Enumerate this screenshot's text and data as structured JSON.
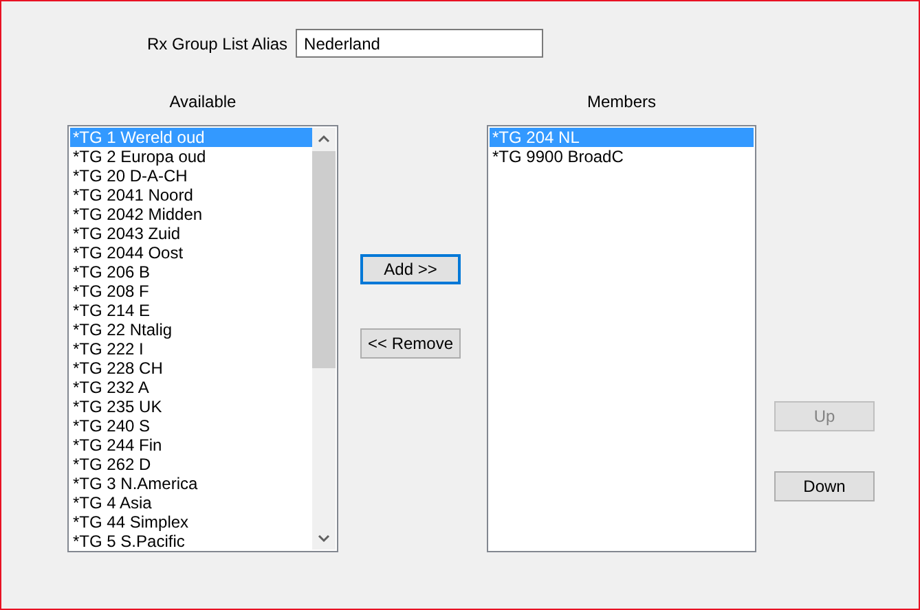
{
  "alias": {
    "label": "Rx Group List Alias",
    "value": "Nederland"
  },
  "available": {
    "label": "Available",
    "items": [
      {
        "text": "*TG 1 Wereld oud",
        "selected": true
      },
      {
        "text": "*TG 2 Europa oud",
        "selected": false
      },
      {
        "text": "*TG 20 D-A-CH",
        "selected": false
      },
      {
        "text": "*TG 2041 Noord",
        "selected": false
      },
      {
        "text": "*TG 2042 Midden",
        "selected": false
      },
      {
        "text": "*TG 2043 Zuid",
        "selected": false
      },
      {
        "text": "*TG 2044 Oost",
        "selected": false
      },
      {
        "text": "*TG 206 B",
        "selected": false
      },
      {
        "text": "*TG 208 F",
        "selected": false
      },
      {
        "text": "*TG 214 E",
        "selected": false
      },
      {
        "text": "*TG 22 Ntalig",
        "selected": false
      },
      {
        "text": "*TG 222 I",
        "selected": false
      },
      {
        "text": "*TG 228 CH",
        "selected": false
      },
      {
        "text": "*TG 232 A",
        "selected": false
      },
      {
        "text": "*TG 235 UK",
        "selected": false
      },
      {
        "text": "*TG 240 S",
        "selected": false
      },
      {
        "text": "*TG 244 Fin",
        "selected": false
      },
      {
        "text": "*TG 262 D",
        "selected": false
      },
      {
        "text": "*TG 3 N.America",
        "selected": false
      },
      {
        "text": "*TG 4 Asia",
        "selected": false
      },
      {
        "text": "*TG 44 Simplex",
        "selected": false
      },
      {
        "text": "*TG 5 S.Pacific",
        "selected": false
      }
    ]
  },
  "transfer_buttons": [
    {
      "label": "Add >>",
      "focused": true
    },
    {
      "label": "<< Remove",
      "focused": false
    }
  ],
  "members": {
    "label": "Members",
    "items": [
      {
        "text": "*TG 204 NL",
        "selected": true
      },
      {
        "text": "*TG 9900 BroadC",
        "selected": false
      }
    ]
  },
  "order_buttons": [
    {
      "label": "Up",
      "disabled": true
    },
    {
      "label": "Down",
      "disabled": false
    }
  ]
}
